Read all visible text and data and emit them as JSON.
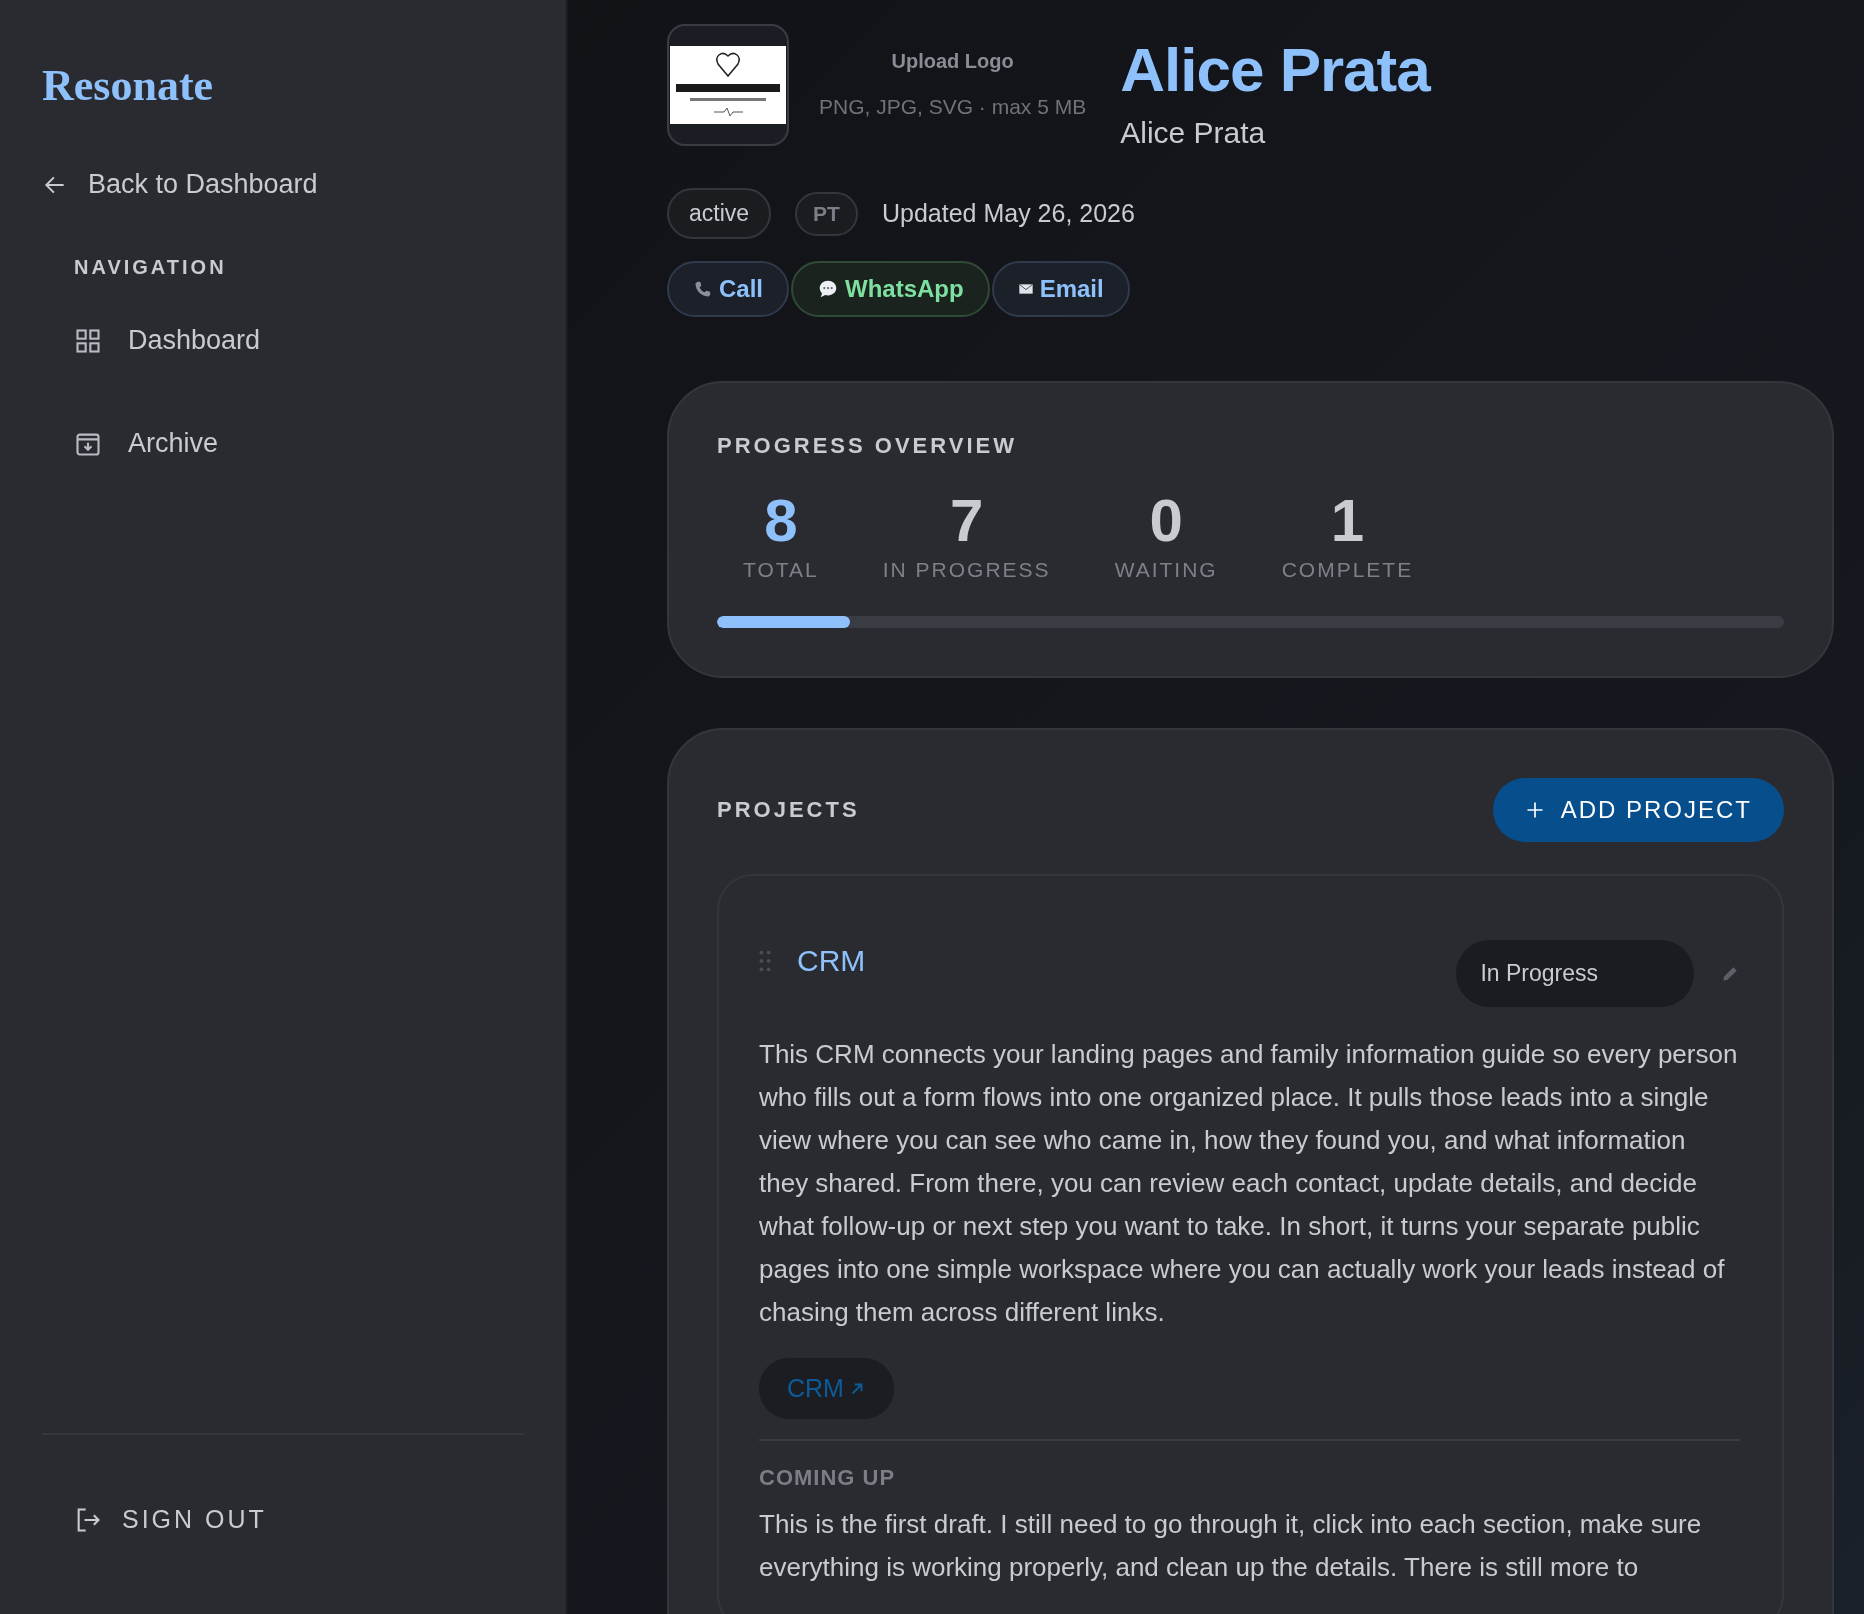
{
  "sidebar": {
    "brand": "Resonate",
    "back_link": "Back to Dashboard",
    "section_label": "NAVIGATION",
    "items": [
      {
        "label": "Dashboard",
        "kind": "grid",
        "selected": false
      },
      {
        "label": "Archive",
        "kind": "archive",
        "selected": false
      }
    ],
    "sign_out": "SIGN OUT"
  },
  "header": {
    "upload_label": "Upload Logo",
    "upload_hint": "PNG, JPG, SVG · max 5 MB",
    "title": "Alice Prata",
    "subtitle": "Alice Prata",
    "status_badge": "active",
    "language_badge": "PT",
    "updated": "Updated May 26, 2026",
    "contact_buttons": [
      {
        "kind": "call",
        "label": "Call"
      },
      {
        "kind": "whatsapp",
        "label": "WhatsApp"
      },
      {
        "kind": "email",
        "label": "Email"
      }
    ]
  },
  "progress": {
    "title": "PROGRESS OVERVIEW",
    "level": 0.125,
    "stats": [
      {
        "value": "8",
        "label": "TOTAL",
        "kind": "accent"
      },
      {
        "value": "7",
        "label": "IN PROGRESS",
        "kind": "plain"
      },
      {
        "value": "0",
        "label": "WAITING",
        "kind": "plain"
      },
      {
        "value": "1",
        "label": "COMPLETE",
        "kind": "plain"
      }
    ]
  },
  "projects": {
    "title": "PROJECTS",
    "add_button": "ADD PROJECT",
    "items": [
      {
        "name": "CRM",
        "status": "In Progress",
        "description": "This CRM connects your landing pages and family information guide so every person who fills out a form flows into one organized place. It pulls those leads into a single view where you can see who came in, how they found you, and what information they shared. From there, you can review each contact, update details, and decide what follow-up or next step you want to take. In short, it turns your separate public pages into one simple workspace where you can actually work your leads instead of chasing them across different links.",
        "link": "CRM",
        "coming_up_label": "COMING UP",
        "coming_up": "This is the first draft. I still need to go through it, click into each section, make sure everything is working properly, and clean up the details. There is still more to"
      }
    ]
  }
}
